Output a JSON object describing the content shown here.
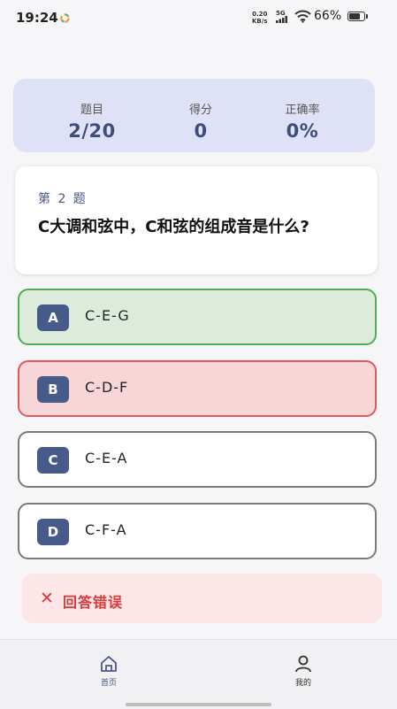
{
  "status_bar": {
    "time": "19:24",
    "net_speed_value": "0.20",
    "net_speed_unit": "KB/s",
    "signal_label": "5G",
    "battery_percent": "66%",
    "battery_level": 0.66
  },
  "stats": {
    "question_label": "题目",
    "question_value": "2/20",
    "score_label": "得分",
    "score_value": "0",
    "accuracy_label": "正确率",
    "accuracy_value": "0%"
  },
  "question": {
    "number_label": "第 2 题",
    "text": "C大调和弦中，C和弦的组成音是什么?"
  },
  "options": [
    {
      "letter": "A",
      "text": "C-E-G",
      "state": "correct"
    },
    {
      "letter": "B",
      "text": "C-D-F",
      "state": "wrong"
    },
    {
      "letter": "C",
      "text": "C-E-A",
      "state": "normal"
    },
    {
      "letter": "D",
      "text": "C-F-A",
      "state": "normal"
    }
  ],
  "result": {
    "icon": "close-icon",
    "text": "回答错误"
  },
  "bottom_nav": {
    "home_label": "首页",
    "profile_label": "我的"
  },
  "colors": {
    "accent": "#475b8a",
    "correct_bg": "#dcebdb",
    "correct_border": "#4caf50",
    "wrong_bg": "#f8d6d8",
    "wrong_border": "#e0575c",
    "error_text": "#d63b3b",
    "stats_bg": "#dfe2f7"
  }
}
